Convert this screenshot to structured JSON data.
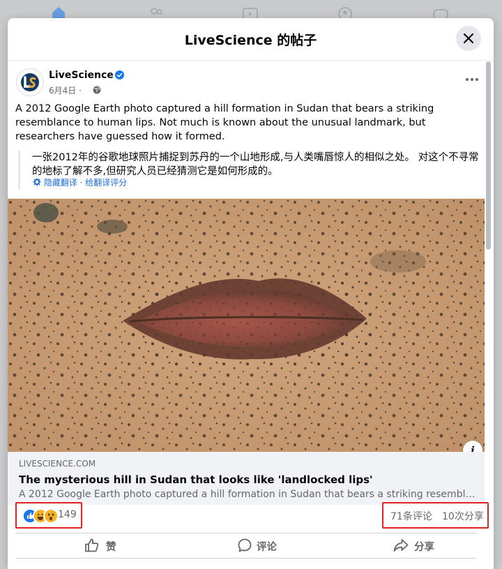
{
  "dialog": {
    "title": "LiveScience 的帖子"
  },
  "post": {
    "page_name": "LiveScience",
    "date": "6月4日 ·",
    "text": "A 2012 Google Earth photo captured a hill formation in Sudan that bears a striking resemblance to human lips. Not much is known about the unusual landmark, but researchers have guessed how it formed.",
    "translation": {
      "text": "一张2012年的谷歌地球照片捕捉到苏丹的一个山地形成,与人类嘴唇惊人的相似之处。 对这个不寻常的地标了解不多,但研究人员已经猜测它是如何形成的。",
      "hide_label": "隐藏翻译",
      "separator": " · ",
      "rate_label": "给翻译评分"
    }
  },
  "link": {
    "domain": "LIVESCIENCE.COM",
    "title": "The mysterious hill in Sudan that looks like 'landlocked lips'",
    "description": "A 2012 Google Earth photo captured a hill formation in Sudan that bears a striking resemblance t..."
  },
  "engagement": {
    "reaction_count": "149",
    "comments": "71条评论",
    "shares": "10次分享"
  },
  "actions": {
    "like": "赞",
    "comment": "评论",
    "share": "分享"
  },
  "colors": {
    "accent": "#1877f2",
    "highlight_box": "#e02424",
    "muted_text": "#65676b"
  }
}
